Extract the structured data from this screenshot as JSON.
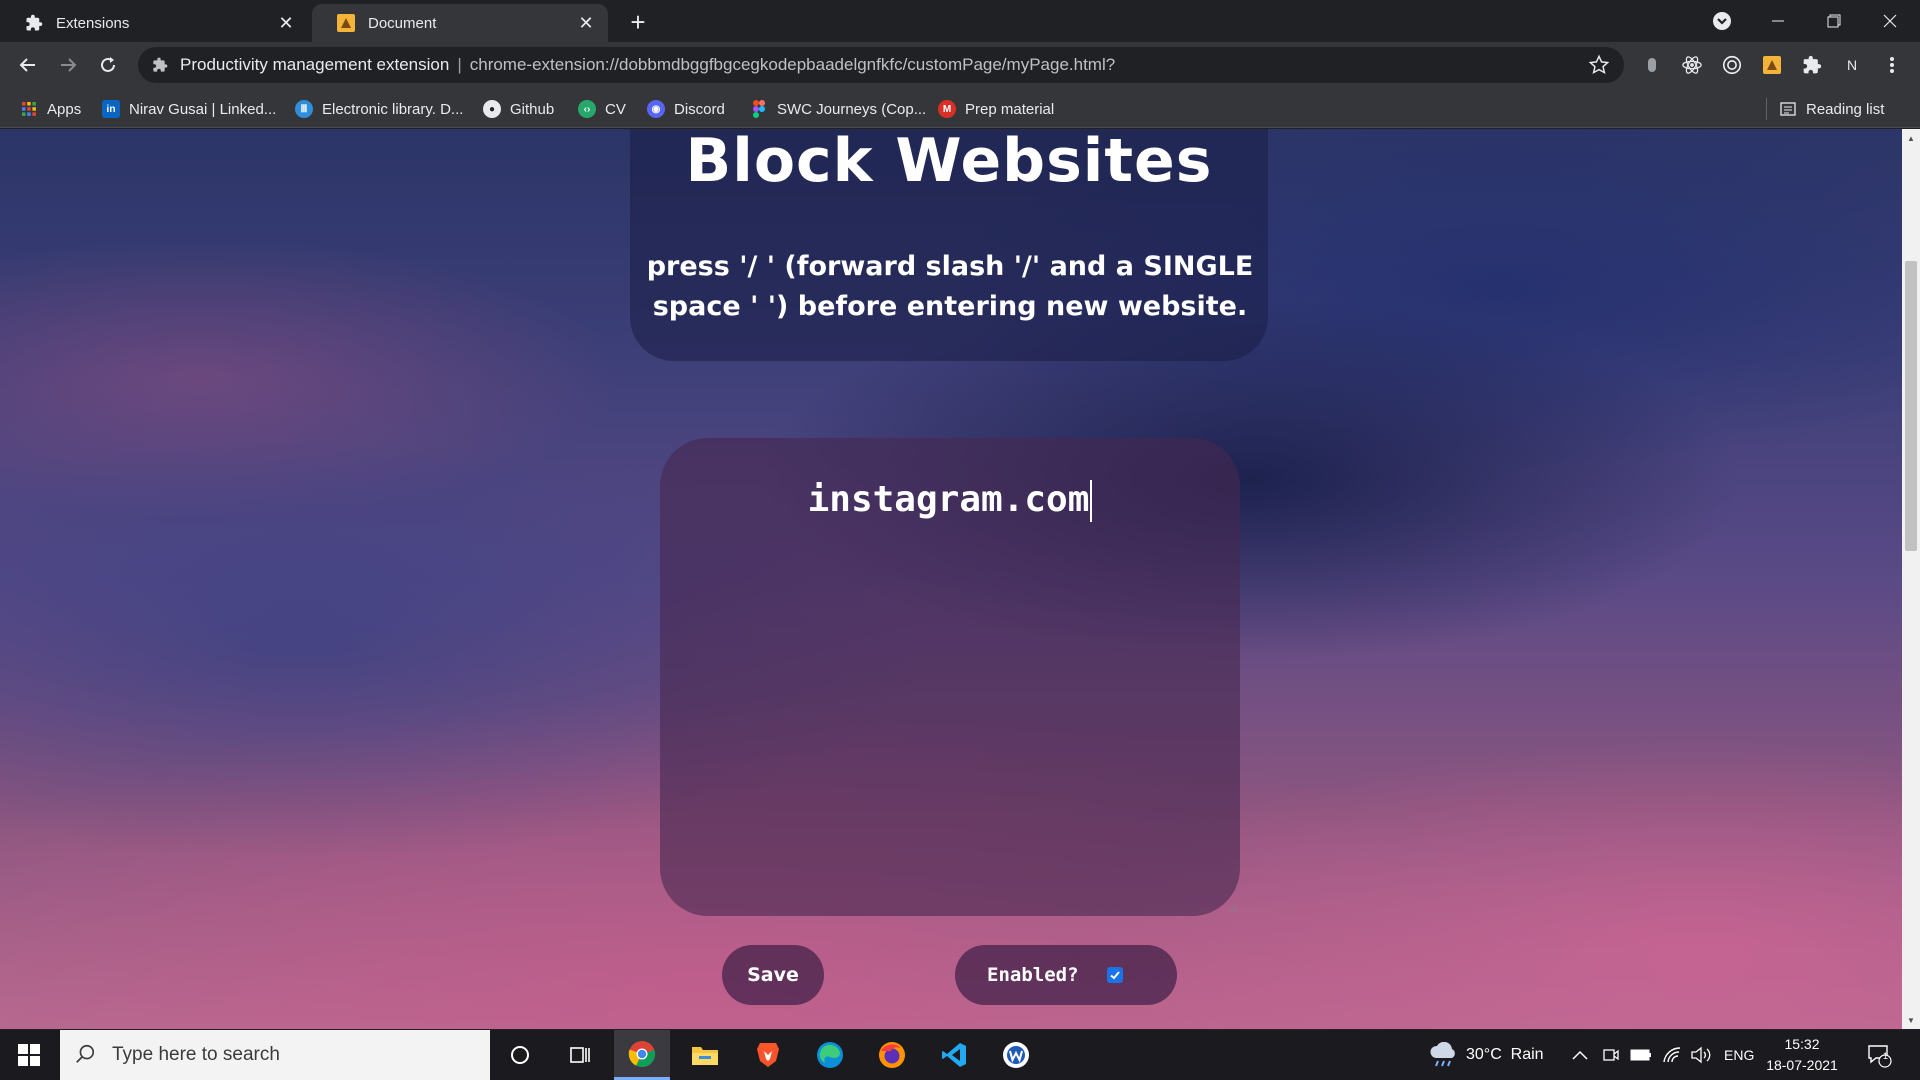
{
  "browser": {
    "tabs": [
      {
        "title": "Extensions",
        "icon": "puzzle-icon",
        "active": false
      },
      {
        "title": "Document",
        "icon": "extension-app-icon",
        "active": true
      }
    ],
    "omnibox": {
      "site_name": "Productivity management extension",
      "separator": "|",
      "url": "chrome-extension://dobbmdbggfbgcegkodepbaadelgnfkfc/customPage/myPage.html?"
    },
    "profile_initial": "N",
    "bookmarks": [
      {
        "label": "Apps",
        "icon": "apps-grid-icon"
      },
      {
        "label": "Nirav Gusai | Linked...",
        "icon": "linkedin-icon"
      },
      {
        "label": "Electronic library. D...",
        "icon": "library-icon"
      },
      {
        "label": "Github",
        "icon": "github-icon"
      },
      {
        "label": "CV",
        "icon": "cv-icon"
      },
      {
        "label": "Discord",
        "icon": "discord-icon"
      },
      {
        "label": "SWC Journeys (Cop...",
        "icon": "figma-icon"
      },
      {
        "label": "Prep material",
        "icon": "gmail-icon"
      }
    ],
    "reading_list": "Reading list"
  },
  "page": {
    "title": "Block Websites",
    "instructions": "press '/ ' (forward slash '/' and a SINGLE space ' ') before entering new website.",
    "editor_value": "instagram.com",
    "save_label": "Save",
    "enabled_label": "Enabled?",
    "enabled_checked": true
  },
  "taskbar": {
    "search_placeholder": "Type here to search",
    "weather": "30°C  Rain",
    "language": "ENG",
    "time": "15:32",
    "date": "18-07-2021",
    "notification_count": "1"
  },
  "colors": {
    "accent": "#1a73e8",
    "chrome_dark": "#202124",
    "chrome_toolbar": "#35363a"
  }
}
